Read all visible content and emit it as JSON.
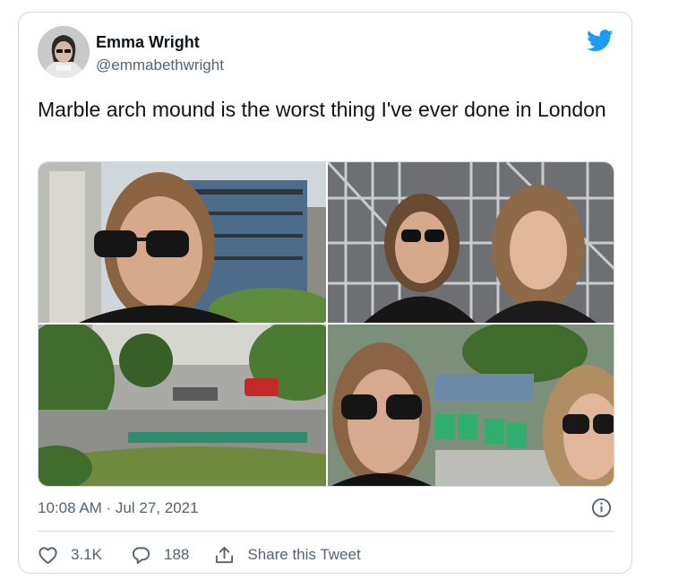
{
  "author": {
    "display_name": "Emma Wright",
    "handle": "@emmabethwright"
  },
  "tweet": {
    "text": "Marble arch mound is the worst thing I've ever done in London",
    "timestamp": "10:08 AM · Jul 27, 2021"
  },
  "media": {
    "photos": [
      "photo-1",
      "photo-2",
      "photo-3",
      "photo-4"
    ]
  },
  "actions": {
    "likes": "3.1K",
    "replies": "188",
    "share_label": "Share this Tweet"
  },
  "icons": {
    "brand": "twitter-bird-icon",
    "info": "info-icon",
    "like": "heart-icon",
    "reply": "reply-bubble-icon",
    "share": "share-icon"
  },
  "colors": {
    "brand_blue": "#1d9bf0",
    "secondary_text": "#536471",
    "border": "#cfd9de"
  }
}
